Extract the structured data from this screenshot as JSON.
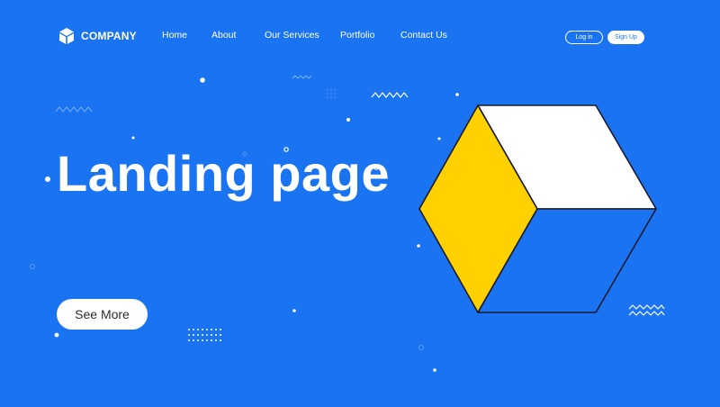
{
  "brand": {
    "name": "COMPANY",
    "logo_icon": "cube-icon",
    "background_color": "#1a74f2",
    "accent_yellow": "#ffd100"
  },
  "nav": {
    "items": [
      {
        "label": "Home"
      },
      {
        "label": "About"
      },
      {
        "label": "Our Services"
      },
      {
        "label": "Portfolio"
      },
      {
        "label": "Contact Us"
      }
    ],
    "login_label": "Log in",
    "signup_label": "Sign Up"
  },
  "hero": {
    "title": "Landing page",
    "cta_label": "See More"
  }
}
